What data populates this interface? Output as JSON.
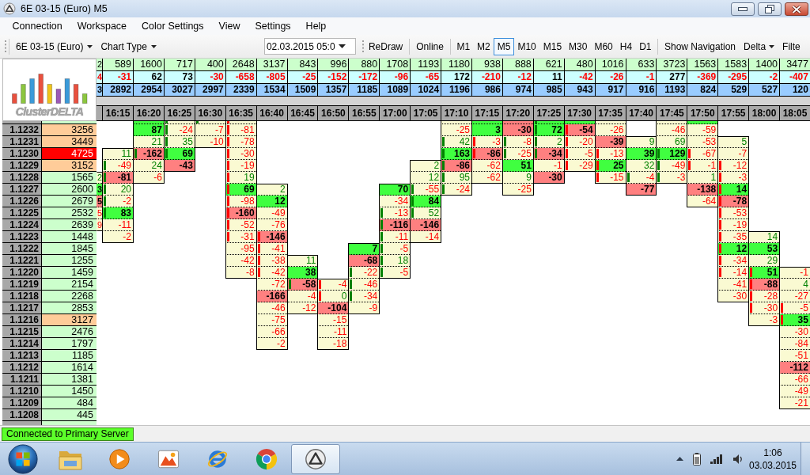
{
  "window": {
    "title": "6E 03-15 (Euro) M5"
  },
  "menu": [
    "Connection",
    "Workspace",
    "Color Settings",
    "View",
    "Settings",
    "Help"
  ],
  "toolbar": {
    "instrument": "6E 03-15 (Euro)",
    "chart_type": "Chart Type",
    "date": "02.03.2015 05:0",
    "redraw": "ReDraw",
    "online": "Online",
    "timeframes": [
      {
        "label": "M1",
        "selected": false
      },
      {
        "label": "M2",
        "selected": false
      },
      {
        "label": "M5",
        "selected": true
      },
      {
        "label": "M10",
        "selected": false
      },
      {
        "label": "M15",
        "selected": false
      },
      {
        "label": "M30",
        "selected": false
      },
      {
        "label": "M60",
        "selected": false
      },
      {
        "label": "H4",
        "selected": false
      },
      {
        "label": "D1",
        "selected": false
      }
    ],
    "show_navigation": "Show Navigation",
    "delta": "Delta",
    "last_item": "Filte"
  },
  "logo": "ClusterDELTA",
  "prices": [
    {
      "price": "1.1232",
      "volume": "3256",
      "kind": "high"
    },
    {
      "price": "1.1231",
      "volume": "3449",
      "kind": "high"
    },
    {
      "price": "1.1230",
      "volume": "4725",
      "kind": "peak"
    },
    {
      "price": "1.1229",
      "volume": "3152",
      "kind": "high"
    },
    {
      "price": "1.1228",
      "volume": "1565",
      "kind": "normal"
    },
    {
      "price": "1.1227",
      "volume": "2600",
      "kind": "normal"
    },
    {
      "price": "1.1226",
      "volume": "2679",
      "kind": "normal"
    },
    {
      "price": "1.1225",
      "volume": "2532",
      "kind": "normal"
    },
    {
      "price": "1.1224",
      "volume": "2639",
      "kind": "normal"
    },
    {
      "price": "1.1223",
      "volume": "1448",
      "kind": "normal"
    },
    {
      "price": "1.1222",
      "volume": "1845",
      "kind": "normal"
    },
    {
      "price": "1.1221",
      "volume": "1255",
      "kind": "normal"
    },
    {
      "price": "1.1220",
      "volume": "1459",
      "kind": "normal"
    },
    {
      "price": "1.1219",
      "volume": "2154",
      "kind": "normal"
    },
    {
      "price": "1.1218",
      "volume": "2268",
      "kind": "normal"
    },
    {
      "price": "1.1217",
      "volume": "2853",
      "kind": "normal"
    },
    {
      "price": "1.1216",
      "volume": "3127",
      "kind": "high"
    },
    {
      "price": "1.1215",
      "volume": "2476",
      "kind": "normal"
    },
    {
      "price": "1.1214",
      "volume": "1797",
      "kind": "normal"
    },
    {
      "price": "1.1213",
      "volume": "1185",
      "kind": "normal"
    },
    {
      "price": "1.1212",
      "volume": "1614",
      "kind": "normal"
    },
    {
      "price": "1.1211",
      "volume": "1381",
      "kind": "normal"
    },
    {
      "price": "1.1210",
      "volume": "1450",
      "kind": "normal"
    },
    {
      "price": "1.1209",
      "volume": "484",
      "kind": "normal"
    },
    {
      "price": "1.1208",
      "volume": "445",
      "kind": "normal"
    }
  ],
  "columns": [
    {
      "kind": "clipped",
      "volume": "2",
      "delta": {
        "value": "4",
        "kind": "neg"
      },
      "total": "3",
      "cells": [
        null,
        null,
        null,
        null,
        null,
        {
          "value": "2",
          "kind": "pos"
        },
        {
          "value": "3",
          "kind": "maxpos"
        },
        {
          "value": "5",
          "kind": "maxneg"
        },
        {
          "value": "5",
          "kind": "neg"
        },
        {
          "value": "9",
          "kind": "neg"
        }
      ]
    },
    {
      "kind": "full",
      "time": "16:15",
      "volume": "589",
      "delta": {
        "value": "-31",
        "kind": "neg"
      },
      "total": "2892",
      "cells": [
        null,
        null,
        null,
        {
          "value": "11",
          "kind": "pos"
        },
        {
          "value": "-49",
          "kind": "neg",
          "marker": {
            "color": "#008000"
          }
        },
        {
          "value": "-81",
          "kind": "maxneg",
          "marker": {
            "color": "#008000"
          }
        },
        {
          "value": "20",
          "kind": "pos",
          "marker": {
            "color": "#008000"
          }
        },
        {
          "value": "-2",
          "kind": "neg",
          "marker": {
            "color": "#008000"
          }
        },
        {
          "value": "83",
          "kind": "maxpos",
          "marker": {
            "color": "#008000"
          }
        },
        {
          "value": "-11",
          "kind": "neg"
        },
        {
          "value": "-2",
          "kind": "neg"
        }
      ]
    },
    {
      "kind": "full",
      "time": "16:20",
      "volume": "1600",
      "delta": {
        "value": "62",
        "kind": "pos"
      },
      "total": "2954",
      "cells": [
        {
          "kind": "maxpos"
        },
        {
          "value": "87",
          "kind": "maxpos"
        },
        {
          "value": "21",
          "kind": "pos"
        },
        {
          "value": "-162",
          "kind": "maxneg",
          "marker": {
            "color": "#008000"
          }
        },
        {
          "value": "24",
          "kind": "pos"
        },
        {
          "value": "-6",
          "kind": "neg"
        }
      ]
    },
    {
      "kind": "full",
      "time": "16:25",
      "volume": "717",
      "delta": {
        "value": "73",
        "kind": "pos"
      },
      "total": "3027",
      "cells": [
        {
          "kind": "plain",
          "marker": {
            "color": "#008000"
          }
        },
        {
          "value": "-24",
          "kind": "neg",
          "marker": {
            "color": "#008000"
          }
        },
        {
          "value": "35",
          "kind": "pos",
          "marker": {
            "color": "#008000"
          }
        },
        {
          "value": "69",
          "kind": "maxpos",
          "marker": {
            "color": "#008000"
          }
        },
        {
          "value": "-43",
          "kind": "maxneg"
        }
      ]
    },
    {
      "kind": "full",
      "time": "16:30",
      "volume": "400",
      "delta": {
        "value": "-30",
        "kind": "neg"
      },
      "total": "2997",
      "cells": [
        {
          "kind": "plain",
          "marker": {
            "color": "#008000"
          }
        },
        {
          "value": "-7",
          "kind": "neg"
        },
        {
          "value": "-10",
          "kind": "neg"
        }
      ]
    },
    {
      "kind": "full",
      "time": "16:35",
      "volume": "2648",
      "delta": {
        "value": "-658",
        "kind": "neg"
      },
      "total": "2339",
      "cells": [
        {
          "kind": "plain",
          "marker": {
            "color": "#ff0000"
          }
        },
        {
          "value": "-81",
          "kind": "neg",
          "marker": {
            "color": "#ff0000"
          }
        },
        {
          "value": "-78",
          "kind": "neg",
          "marker": {
            "color": "#ff0000"
          }
        },
        {
          "value": "-30",
          "kind": "neg",
          "marker": {
            "color": "#ff0000"
          }
        },
        {
          "value": "-19",
          "kind": "neg",
          "marker": {
            "color": "#ff0000"
          }
        },
        {
          "value": "19",
          "kind": "pos",
          "marker": {
            "color": "#ff0000"
          }
        },
        {
          "value": "69",
          "kind": "maxpos",
          "marker": {
            "color": "#ff0000"
          }
        },
        {
          "value": "-98",
          "kind": "neg",
          "marker": {
            "color": "#ff0000"
          }
        },
        {
          "value": "-160",
          "kind": "maxneg",
          "marker": {
            "color": "#ff0000"
          }
        },
        {
          "value": "-52",
          "kind": "neg",
          "marker": {
            "color": "#ff0000"
          }
        },
        {
          "value": "-31",
          "kind": "neg",
          "marker": {
            "color": "#ff0000"
          }
        },
        {
          "value": "-95",
          "kind": "neg"
        },
        {
          "value": "-42",
          "kind": "neg"
        },
        {
          "value": "-8",
          "kind": "neg"
        }
      ]
    },
    {
      "kind": "full",
      "time": "16:40",
      "volume": "3137",
      "delta": {
        "value": "-805",
        "kind": "neg"
      },
      "total": "1534",
      "cells": [
        null,
        null,
        null,
        null,
        null,
        null,
        {
          "value": "2",
          "kind": "pos"
        },
        {
          "value": "12",
          "kind": "maxpos"
        },
        {
          "value": "-49",
          "kind": "neg"
        },
        {
          "value": "-76",
          "kind": "neg"
        },
        {
          "value": "-146",
          "kind": "maxneg",
          "marker": {
            "color": "#ff0000"
          }
        },
        {
          "value": "-41",
          "kind": "neg",
          "marker": {
            "color": "#ff0000"
          }
        },
        {
          "value": "-38",
          "kind": "neg",
          "marker": {
            "color": "#ff0000"
          }
        },
        {
          "value": "-42",
          "kind": "neg",
          "marker": {
            "color": "#ff0000"
          }
        },
        {
          "value": "-72",
          "kind": "neg"
        },
        {
          "value": "-166",
          "kind": "maxneg"
        },
        {
          "value": "-46",
          "kind": "neg"
        },
        {
          "value": "-75",
          "kind": "neg"
        },
        {
          "value": "-66",
          "kind": "neg"
        },
        {
          "value": "-2",
          "kind": "neg"
        }
      ]
    },
    {
      "kind": "full",
      "time": "16:45",
      "volume": "843",
      "delta": {
        "value": "-25",
        "kind": "neg"
      },
      "total": "1509",
      "cells": [
        null,
        null,
        null,
        null,
        null,
        null,
        null,
        null,
        null,
        null,
        null,
        null,
        {
          "value": "11",
          "kind": "pos"
        },
        {
          "value": "38",
          "kind": "maxpos"
        },
        {
          "value": "-58",
          "kind": "maxneg",
          "marker": {
            "color": "#008000"
          }
        },
        {
          "value": "-4",
          "kind": "neg"
        },
        {
          "value": "-12",
          "kind": "neg"
        }
      ]
    },
    {
      "kind": "full",
      "time": "16:50",
      "volume": "996",
      "delta": {
        "value": "-152",
        "kind": "neg"
      },
      "total": "1357",
      "cells": [
        null,
        null,
        null,
        null,
        null,
        null,
        null,
        null,
        null,
        null,
        null,
        null,
        null,
        null,
        {
          "value": "-4",
          "kind": "neg",
          "marker": {
            "color": "#ff0000"
          }
        },
        {
          "value": "0",
          "kind": "pos",
          "marker": {
            "color": "#ff0000"
          }
        },
        {
          "value": "-104",
          "kind": "maxneg"
        },
        {
          "value": "-15",
          "kind": "neg"
        },
        {
          "value": "-11",
          "kind": "neg"
        },
        {
          "value": "-18",
          "kind": "neg"
        }
      ]
    },
    {
      "kind": "full",
      "time": "16:55",
      "volume": "880",
      "delta": {
        "value": "-172",
        "kind": "neg"
      },
      "total": "1185",
      "cells": [
        null,
        null,
        null,
        null,
        null,
        null,
        null,
        null,
        null,
        null,
        null,
        {
          "value": "7",
          "kind": "maxpos"
        },
        {
          "value": "-68",
          "kind": "maxneg"
        },
        {
          "value": "-22",
          "kind": "neg",
          "marker": {
            "color": "#008000"
          }
        },
        {
          "value": "-46",
          "kind": "neg",
          "marker": {
            "color": "#008000"
          }
        },
        {
          "value": "-34",
          "kind": "neg",
          "marker": {
            "color": "#008000"
          }
        },
        {
          "value": "-9",
          "kind": "neg"
        }
      ]
    },
    {
      "kind": "full",
      "time": "17:00",
      "volume": "1708",
      "delta": {
        "value": "-96",
        "kind": "neg"
      },
      "total": "1089",
      "cells": [
        null,
        null,
        null,
        null,
        null,
        null,
        {
          "value": "70",
          "kind": "maxpos"
        },
        {
          "value": "-34",
          "kind": "neg"
        },
        {
          "value": "-13",
          "kind": "neg",
          "marker": {
            "color": "#008000"
          }
        },
        {
          "value": "-116",
          "kind": "maxneg",
          "marker": {
            "color": "#008000"
          }
        },
        {
          "value": "-11",
          "kind": "neg",
          "marker": {
            "color": "#008000"
          }
        },
        {
          "value": "-5",
          "kind": "neg",
          "marker": {
            "color": "#008000"
          }
        },
        {
          "value": "18",
          "kind": "pos",
          "marker": {
            "color": "#008000"
          }
        },
        {
          "value": "-5",
          "kind": "neg",
          "marker": {
            "color": "#008000"
          }
        }
      ]
    },
    {
      "kind": "full",
      "time": "17:05",
      "volume": "1193",
      "delta": {
        "value": "-65",
        "kind": "neg"
      },
      "total": "1024",
      "cells": [
        null,
        null,
        null,
        null,
        {
          "value": "2",
          "kind": "pos"
        },
        {
          "value": "12",
          "kind": "pos"
        },
        {
          "value": "-55",
          "kind": "neg",
          "marker": {
            "color": "#008000"
          }
        },
        {
          "value": "84",
          "kind": "maxpos",
          "marker": {
            "color": "#008000"
          }
        },
        {
          "value": "52",
          "kind": "pos",
          "marker": {
            "color": "#008000"
          }
        },
        {
          "value": "-146",
          "kind": "maxneg"
        },
        {
          "value": "-14",
          "kind": "neg"
        }
      ]
    },
    {
      "kind": "full",
      "time": "17:10",
      "volume": "1180",
      "delta": {
        "value": "172",
        "kind": "pos"
      },
      "total": "1196",
      "cells": [
        {
          "kind": "plain"
        },
        {
          "value": "-25",
          "kind": "neg"
        },
        {
          "value": "42",
          "kind": "pos",
          "marker": {
            "color": "#008000"
          }
        },
        {
          "value": "163",
          "kind": "maxpos",
          "marker": {
            "color": "#008000"
          }
        },
        {
          "value": "-86",
          "kind": "maxneg",
          "marker": {
            "color": "#008000"
          }
        },
        {
          "value": "95",
          "kind": "pos",
          "marker": {
            "color": "#008000"
          }
        },
        {
          "value": "-24",
          "kind": "neg",
          "marker": {
            "color": "#008000"
          }
        }
      ]
    },
    {
      "kind": "full",
      "time": "17:15",
      "volume": "938",
      "delta": {
        "value": "-210",
        "kind": "neg"
      },
      "total": "986",
      "cells": [
        {
          "kind": "maxpos"
        },
        {
          "value": "3",
          "kind": "maxpos"
        },
        {
          "value": "-3",
          "kind": "neg",
          "marker": {
            "color": "#ff0000"
          }
        },
        {
          "value": "-86",
          "kind": "maxneg",
          "marker": {
            "color": "#ff0000"
          }
        },
        {
          "value": "-62",
          "kind": "neg"
        },
        {
          "value": "-62",
          "kind": "neg"
        }
      ]
    },
    {
      "kind": "full",
      "time": "17:20",
      "volume": "888",
      "delta": {
        "value": "-12",
        "kind": "neg"
      },
      "total": "974",
      "cells": [
        {
          "kind": "maxneg"
        },
        {
          "value": "-30",
          "kind": "maxneg"
        },
        {
          "value": "-8",
          "kind": "neg",
          "marker": {
            "color": "#008000"
          }
        },
        {
          "value": "-25",
          "kind": "neg",
          "marker": {
            "color": "#008000"
          }
        },
        {
          "value": "51",
          "kind": "maxpos"
        },
        {
          "value": "9",
          "kind": "pos"
        },
        {
          "value": "-25",
          "kind": "neg"
        }
      ]
    },
    {
      "kind": "full",
      "time": "17:25",
      "volume": "621",
      "delta": {
        "value": "11",
        "kind": "pos"
      },
      "total": "985",
      "cells": [
        {
          "kind": "maxpos",
          "marker": {
            "color": "#008000"
          }
        },
        {
          "value": "72",
          "kind": "maxpos",
          "marker": {
            "color": "#008000"
          }
        },
        {
          "value": "2",
          "kind": "pos",
          "marker": {
            "color": "#008000"
          }
        },
        {
          "value": "-34",
          "kind": "maxneg",
          "marker": {
            "color": "#008000"
          }
        },
        {
          "value": "-1",
          "kind": "neg"
        },
        {
          "value": "-30",
          "kind": "maxneg"
        }
      ]
    },
    {
      "kind": "full",
      "time": "17:30",
      "volume": "480",
      "delta": {
        "value": "-42",
        "kind": "neg"
      },
      "total": "943",
      "cells": [
        {
          "kind": "maxpos"
        },
        {
          "value": "-54",
          "kind": "maxneg",
          "marker": {
            "color": "#ff0000"
          }
        },
        {
          "value": "-20",
          "kind": "neg",
          "marker": {
            "color": "#ff0000"
          }
        },
        {
          "value": "-5",
          "kind": "neg",
          "marker": {
            "color": "#ff0000"
          }
        },
        {
          "value": "-29",
          "kind": "neg",
          "marker": {
            "color": "#ff0000"
          }
        }
      ]
    },
    {
      "kind": "full",
      "time": "17:35",
      "volume": "1016",
      "delta": {
        "value": "-26",
        "kind": "neg"
      },
      "total": "917",
      "cells": [
        {
          "kind": "plain"
        },
        {
          "value": "-26",
          "kind": "neg"
        },
        {
          "value": "-39",
          "kind": "maxneg"
        },
        {
          "value": "-13",
          "kind": "neg",
          "marker": {
            "color": "#ff0000"
          }
        },
        {
          "value": "25",
          "kind": "maxpos",
          "marker": {
            "color": "#ff0000"
          }
        },
        {
          "value": "-15",
          "kind": "neg",
          "marker": {
            "color": "#ff0000"
          }
        }
      ]
    },
    {
      "kind": "full",
      "time": "17:40",
      "volume": "633",
      "delta": {
        "value": "-1",
        "kind": "neg"
      },
      "total": "916",
      "cells": [
        null,
        null,
        {
          "value": "9",
          "kind": "pos"
        },
        {
          "value": "39",
          "kind": "maxpos"
        },
        {
          "value": "32",
          "kind": "pos"
        },
        {
          "value": "-4",
          "kind": "neg",
          "marker": {
            "color": "#008000"
          }
        },
        {
          "value": "-77",
          "kind": "maxneg"
        }
      ]
    },
    {
      "kind": "full",
      "time": "17:45",
      "volume": "3723",
      "delta": {
        "value": "277",
        "kind": "pos"
      },
      "total": "1193",
      "cells": [
        {
          "kind": "plain"
        },
        {
          "value": "-46",
          "kind": "neg"
        },
        {
          "value": "69",
          "kind": "pos"
        },
        {
          "value": "129",
          "kind": "maxpos",
          "marker": {
            "color": "#008000"
          }
        },
        {
          "value": "-49",
          "kind": "neg",
          "marker": {
            "color": "#008000"
          }
        },
        {
          "value": "-3",
          "kind": "neg",
          "marker": {
            "color": "#008000"
          }
        }
      ]
    },
    {
      "kind": "full",
      "time": "17:50",
      "volume": "1563",
      "delta": {
        "value": "-369",
        "kind": "neg"
      },
      "total": "824",
      "cells": [
        {
          "kind": "maxpos"
        },
        {
          "value": "-59",
          "kind": "neg"
        },
        {
          "value": "-53",
          "kind": "neg"
        },
        {
          "value": "-67",
          "kind": "neg",
          "marker": {
            "color": "#ff0000"
          }
        },
        {
          "value": "-1",
          "kind": "neg",
          "marker": {
            "color": "#ff0000"
          }
        },
        {
          "value": "1",
          "kind": "pos"
        },
        {
          "value": "-138",
          "kind": "maxneg"
        },
        {
          "value": "-64",
          "kind": "neg"
        }
      ]
    },
    {
      "kind": "full",
      "time": "17:55",
      "volume": "1583",
      "delta": {
        "value": "-295",
        "kind": "neg"
      },
      "total": "529",
      "cells": [
        null,
        null,
        {
          "value": "5",
          "kind": "pos"
        },
        {
          "value": "-7",
          "kind": "neg"
        },
        {
          "value": "-12",
          "kind": "neg",
          "marker": {
            "color": "#ff0000"
          }
        },
        {
          "value": "-3",
          "kind": "neg",
          "marker": {
            "color": "#ff0000"
          }
        },
        {
          "value": "14",
          "kind": "maxpos",
          "marker": {
            "color": "#ff0000"
          }
        },
        {
          "value": "-78",
          "kind": "maxneg",
          "marker": {
            "color": "#ff0000"
          }
        },
        {
          "value": "-53",
          "kind": "neg",
          "marker": {
            "color": "#ff0000"
          }
        },
        {
          "value": "-19",
          "kind": "neg",
          "marker": {
            "color": "#ff0000"
          }
        },
        {
          "value": "-35",
          "kind": "neg",
          "marker": {
            "color": "#ff0000"
          }
        },
        {
          "value": "12",
          "kind": "maxpos",
          "marker": {
            "color": "#ff0000"
          }
        },
        {
          "value": "-34",
          "kind": "neg",
          "marker": {
            "color": "#ff0000"
          }
        },
        {
          "value": "-14",
          "kind": "neg",
          "marker": {
            "color": "#ff0000"
          }
        },
        {
          "value": "-41",
          "kind": "neg"
        },
        {
          "value": "-30",
          "kind": "neg"
        }
      ]
    },
    {
      "kind": "full",
      "time": "18:00",
      "volume": "1400",
      "delta": {
        "value": "-2",
        "kind": "neg"
      },
      "total": "527",
      "cells": [
        null,
        null,
        null,
        null,
        null,
        null,
        null,
        null,
        null,
        null,
        {
          "value": "14",
          "kind": "pos"
        },
        {
          "value": "53",
          "kind": "maxpos"
        },
        {
          "value": "29",
          "kind": "pos"
        },
        {
          "value": "51",
          "kind": "maxpos",
          "marker": {
            "color": "#ff0000"
          }
        },
        {
          "value": "-88",
          "kind": "maxneg",
          "marker": {
            "color": "#ff0000"
          }
        },
        {
          "value": "-28",
          "kind": "neg",
          "marker": {
            "color": "#ff0000"
          }
        },
        {
          "value": "-30",
          "kind": "neg",
          "marker": {
            "color": "#ff0000"
          }
        },
        {
          "value": "-3",
          "kind": "neg"
        }
      ]
    },
    {
      "kind": "full",
      "time": "18:05",
      "volume": "3477",
      "delta": {
        "value": "-407",
        "kind": "neg"
      },
      "total": "120",
      "cells": [
        null,
        null,
        null,
        null,
        null,
        null,
        null,
        null,
        null,
        null,
        null,
        null,
        null,
        {
          "value": "-1",
          "kind": "neg"
        },
        {
          "value": "4",
          "kind": "pos"
        },
        {
          "value": "-27",
          "kind": "neg"
        },
        {
          "value": "-5",
          "kind": "neg",
          "marker": {
            "color": "#ff0000"
          }
        },
        {
          "value": "35",
          "kind": "maxpos",
          "marker": {
            "color": "#ff0000"
          }
        },
        {
          "value": "-30",
          "kind": "neg"
        },
        {
          "value": "-84",
          "kind": "neg"
        },
        {
          "value": "-51",
          "kind": "neg"
        },
        {
          "value": "-112",
          "kind": "maxneg"
        },
        {
          "value": "-66",
          "kind": "neg"
        },
        {
          "value": "-49",
          "kind": "neg"
        },
        {
          "value": "-21",
          "kind": "neg"
        }
      ]
    }
  ],
  "status_bar": {
    "text": "Connected to Primary Server"
  },
  "taskbar": {
    "apps": [
      {
        "kind": "folder",
        "selected": false
      },
      {
        "kind": "player",
        "selected": false
      },
      {
        "kind": "paint",
        "selected": false
      },
      {
        "kind": "globe",
        "selected": false
      },
      {
        "kind": "wheel",
        "selected": false
      },
      {
        "kind": "triangle",
        "selected": true
      }
    ],
    "time": "1:06",
    "date": "03.03.2015"
  }
}
